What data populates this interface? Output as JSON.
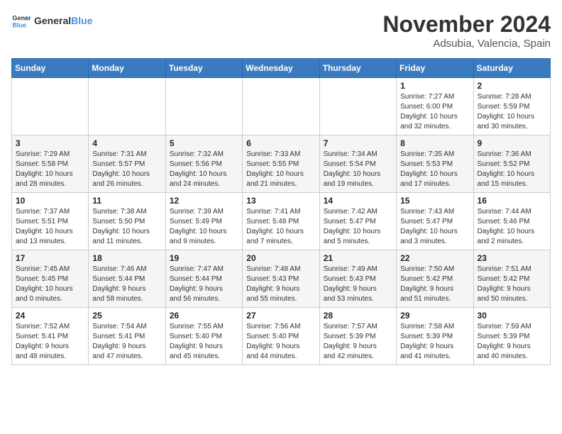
{
  "header": {
    "logo_line1": "General",
    "logo_line2": "Blue",
    "month_year": "November 2024",
    "location": "Adsubia, Valencia, Spain"
  },
  "weekdays": [
    "Sunday",
    "Monday",
    "Tuesday",
    "Wednesday",
    "Thursday",
    "Friday",
    "Saturday"
  ],
  "weeks": [
    [
      {
        "day": "",
        "info": ""
      },
      {
        "day": "",
        "info": ""
      },
      {
        "day": "",
        "info": ""
      },
      {
        "day": "",
        "info": ""
      },
      {
        "day": "",
        "info": ""
      },
      {
        "day": "1",
        "info": "Sunrise: 7:27 AM\nSunset: 6:00 PM\nDaylight: 10 hours\nand 32 minutes."
      },
      {
        "day": "2",
        "info": "Sunrise: 7:28 AM\nSunset: 5:59 PM\nDaylight: 10 hours\nand 30 minutes."
      }
    ],
    [
      {
        "day": "3",
        "info": "Sunrise: 7:29 AM\nSunset: 5:58 PM\nDaylight: 10 hours\nand 28 minutes."
      },
      {
        "day": "4",
        "info": "Sunrise: 7:31 AM\nSunset: 5:57 PM\nDaylight: 10 hours\nand 26 minutes."
      },
      {
        "day": "5",
        "info": "Sunrise: 7:32 AM\nSunset: 5:56 PM\nDaylight: 10 hours\nand 24 minutes."
      },
      {
        "day": "6",
        "info": "Sunrise: 7:33 AM\nSunset: 5:55 PM\nDaylight: 10 hours\nand 21 minutes."
      },
      {
        "day": "7",
        "info": "Sunrise: 7:34 AM\nSunset: 5:54 PM\nDaylight: 10 hours\nand 19 minutes."
      },
      {
        "day": "8",
        "info": "Sunrise: 7:35 AM\nSunset: 5:53 PM\nDaylight: 10 hours\nand 17 minutes."
      },
      {
        "day": "9",
        "info": "Sunrise: 7:36 AM\nSunset: 5:52 PM\nDaylight: 10 hours\nand 15 minutes."
      }
    ],
    [
      {
        "day": "10",
        "info": "Sunrise: 7:37 AM\nSunset: 5:51 PM\nDaylight: 10 hours\nand 13 minutes."
      },
      {
        "day": "11",
        "info": "Sunrise: 7:38 AM\nSunset: 5:50 PM\nDaylight: 10 hours\nand 11 minutes."
      },
      {
        "day": "12",
        "info": "Sunrise: 7:39 AM\nSunset: 5:49 PM\nDaylight: 10 hours\nand 9 minutes."
      },
      {
        "day": "13",
        "info": "Sunrise: 7:41 AM\nSunset: 5:48 PM\nDaylight: 10 hours\nand 7 minutes."
      },
      {
        "day": "14",
        "info": "Sunrise: 7:42 AM\nSunset: 5:47 PM\nDaylight: 10 hours\nand 5 minutes."
      },
      {
        "day": "15",
        "info": "Sunrise: 7:43 AM\nSunset: 5:47 PM\nDaylight: 10 hours\nand 3 minutes."
      },
      {
        "day": "16",
        "info": "Sunrise: 7:44 AM\nSunset: 5:46 PM\nDaylight: 10 hours\nand 2 minutes."
      }
    ],
    [
      {
        "day": "17",
        "info": "Sunrise: 7:45 AM\nSunset: 5:45 PM\nDaylight: 10 hours\nand 0 minutes."
      },
      {
        "day": "18",
        "info": "Sunrise: 7:46 AM\nSunset: 5:44 PM\nDaylight: 9 hours\nand 58 minutes."
      },
      {
        "day": "19",
        "info": "Sunrise: 7:47 AM\nSunset: 5:44 PM\nDaylight: 9 hours\nand 56 minutes."
      },
      {
        "day": "20",
        "info": "Sunrise: 7:48 AM\nSunset: 5:43 PM\nDaylight: 9 hours\nand 55 minutes."
      },
      {
        "day": "21",
        "info": "Sunrise: 7:49 AM\nSunset: 5:43 PM\nDaylight: 9 hours\nand 53 minutes."
      },
      {
        "day": "22",
        "info": "Sunrise: 7:50 AM\nSunset: 5:42 PM\nDaylight: 9 hours\nand 51 minutes."
      },
      {
        "day": "23",
        "info": "Sunrise: 7:51 AM\nSunset: 5:42 PM\nDaylight: 9 hours\nand 50 minutes."
      }
    ],
    [
      {
        "day": "24",
        "info": "Sunrise: 7:52 AM\nSunset: 5:41 PM\nDaylight: 9 hours\nand 48 minutes."
      },
      {
        "day": "25",
        "info": "Sunrise: 7:54 AM\nSunset: 5:41 PM\nDaylight: 9 hours\nand 47 minutes."
      },
      {
        "day": "26",
        "info": "Sunrise: 7:55 AM\nSunset: 5:40 PM\nDaylight: 9 hours\nand 45 minutes."
      },
      {
        "day": "27",
        "info": "Sunrise: 7:56 AM\nSunset: 5:40 PM\nDaylight: 9 hours\nand 44 minutes."
      },
      {
        "day": "28",
        "info": "Sunrise: 7:57 AM\nSunset: 5:39 PM\nDaylight: 9 hours\nand 42 minutes."
      },
      {
        "day": "29",
        "info": "Sunrise: 7:58 AM\nSunset: 5:39 PM\nDaylight: 9 hours\nand 41 minutes."
      },
      {
        "day": "30",
        "info": "Sunrise: 7:59 AM\nSunset: 5:39 PM\nDaylight: 9 hours\nand 40 minutes."
      }
    ]
  ]
}
